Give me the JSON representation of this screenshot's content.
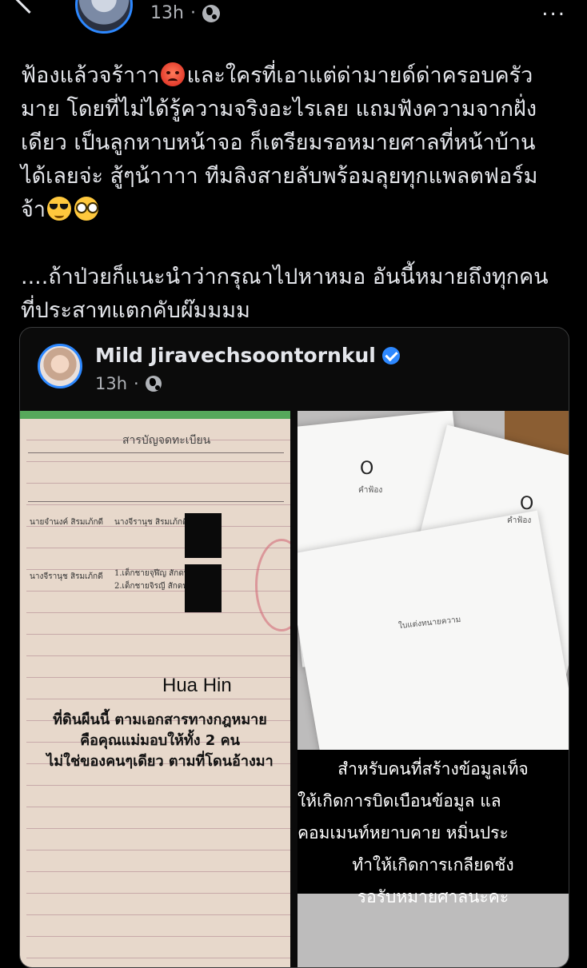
{
  "header": {
    "time": "13h",
    "separator": "·",
    "more_label": "..."
  },
  "post": {
    "line1": "ฟ้องแล้วจร้าาา",
    "line1b": "และใครที่เอาแต่ด่ามายด์ด่าครอบครัว",
    "line2": "มาย โดยที่ไม่ได้รู้ความจริงอะไรเลย แถมฟังความจากฝั่ง",
    "line3": "เดียว เป็นลูกหาบหน้าจอ ก็เตรียมรอหมายศาลที่หน้าบ้าน",
    "line4": "ได้เลยจ่ะ สู้ๆน้าาาา ทีมลิงสายลับพร้อมลุยทุกแพลตฟอร์ม",
    "line5": "จ้า",
    "line6": "....ถ้าป่วยก็แนะนำว่ากรุณาไปหาหมอ อันนี้หมายถึงทุกคน",
    "line7": "ที่ประสาทแตกคับผ๊มมมม"
  },
  "emoji": {
    "angry": "angry-face-emoji",
    "cool": "sunglasses-face-emoji",
    "nerd": "nerd-face-emoji"
  },
  "shared_post": {
    "author": "Mild Jiravechsoontornkul",
    "time": "13h",
    "separator": "·"
  },
  "left_photo": {
    "doc_title": "สารบัญจดทะเบียน",
    "row1_a": "นายจำนงค์ สิรมเภ้กดี",
    "row1_b": "นางจีรานุช สิรมเภ้กดี",
    "row2_a": "นางจีรานุช สิรมเภ้กดี",
    "row2_b1": "1.เด็กชายจุฬีญ สักดท",
    "row2_b2": "2.เด็กชายจิรญี สักดท",
    "location": "Hua Hin",
    "overlay1": "ที่ดินผืนนี้ ตามเอกสารทางกฎหมาย",
    "overlay2": "คือคุณแม่มอบให้ทั้ง 2 คน",
    "overlay3": "ไม่ใช่ของคนๆเดียว ตามที่โดนอ้างมา"
  },
  "right_photo": {
    "doc1": "คำฟ้อง",
    "doc2": "คำฟ้อง",
    "doc3": "ใบแต่งทนายความ",
    "caption1": "สำหรับคนที่สร้างข้อมูลเท็จ",
    "caption2": "ให้เกิดการบิดเบือนข้อมูล แล",
    "caption3": "คอมเมนท์หยาบคาย หมิ่นประ",
    "caption4": "ทำให้เกิดการเกลียดชัง",
    "caption5": "รอรับหมายศาลนะคะ"
  }
}
